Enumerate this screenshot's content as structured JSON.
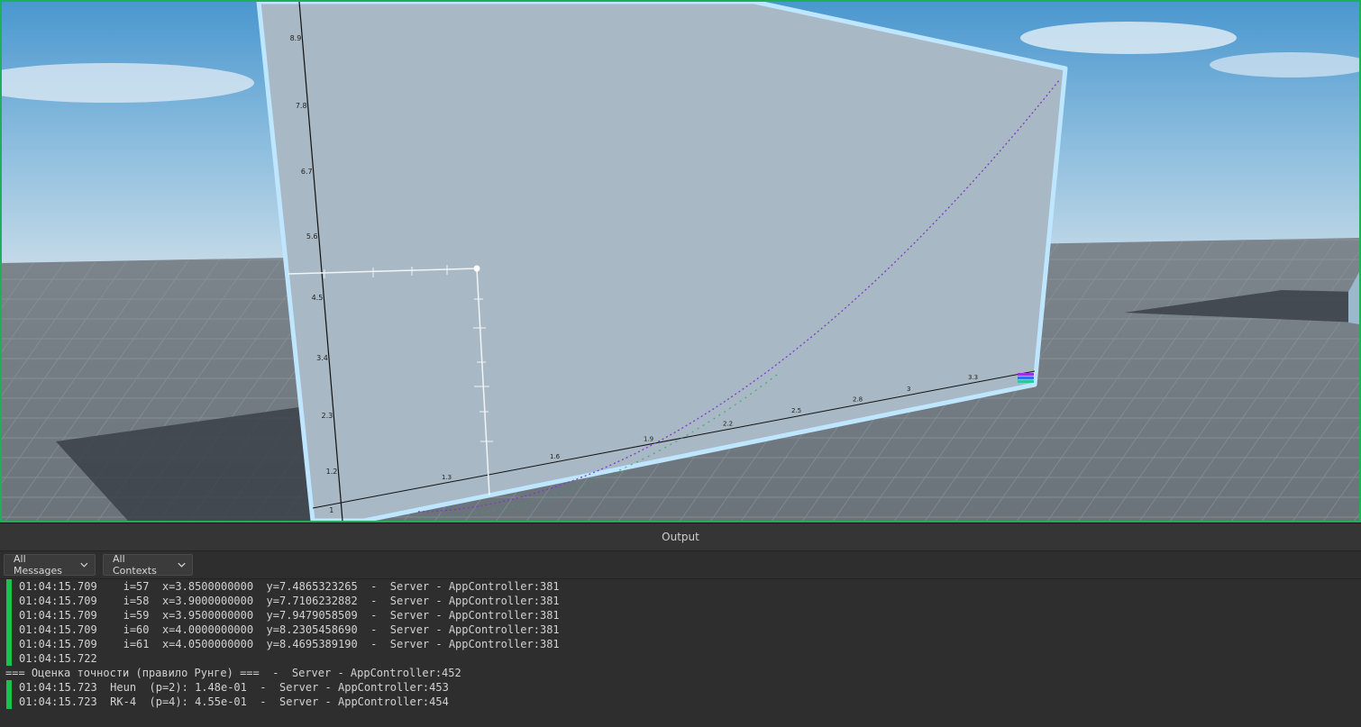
{
  "panel": {
    "title": "Output",
    "filter_messages": "All Messages",
    "filter_contexts": "All Contexts"
  },
  "colors": {
    "log_marker": "#18c24b",
    "viewport_border": "#1fae5a",
    "board_frame": "#bfe6ff",
    "curve": "#7d3cc8"
  },
  "viewport": {
    "y_ticks": [
      "8.9",
      "7.8",
      "6.7",
      "5.6",
      "4.5",
      "3.4",
      "2.3",
      "1.2",
      "1"
    ],
    "x_ticks": [
      "1.3",
      "1.6",
      "1.9",
      "2.2",
      "2.5",
      "2.8",
      "3",
      "3.3"
    ]
  },
  "log": [
    {
      "marker": true,
      "text": "01:04:15.709    i=57  x=3.8500000000  y=7.4865323265  -  Server - AppController:381"
    },
    {
      "marker": true,
      "text": "01:04:15.709    i=58  x=3.9000000000  y=7.7106232882  -  Server - AppController:381"
    },
    {
      "marker": true,
      "text": "01:04:15.709    i=59  x=3.9500000000  y=7.9479058509  -  Server - AppController:381"
    },
    {
      "marker": true,
      "text": "01:04:15.709    i=60  x=4.0000000000  y=8.2305458690  -  Server - AppController:381"
    },
    {
      "marker": true,
      "text": "01:04:15.709    i=61  x=4.0500000000  y=8.4695389190  -  Server - AppController:381"
    },
    {
      "marker": true,
      "text": "01:04:15.722"
    },
    {
      "marker": false,
      "text": "=== Оценка точности (правило Рунге) ===  -  Server - AppController:452"
    },
    {
      "marker": true,
      "text": "01:04:15.723  Heun  (p=2): 1.48e-01  -  Server - AppController:453"
    },
    {
      "marker": true,
      "text": "01:04:15.723  RK-4  (p=4): 4.55e-01  -  Server - AppController:454"
    }
  ]
}
